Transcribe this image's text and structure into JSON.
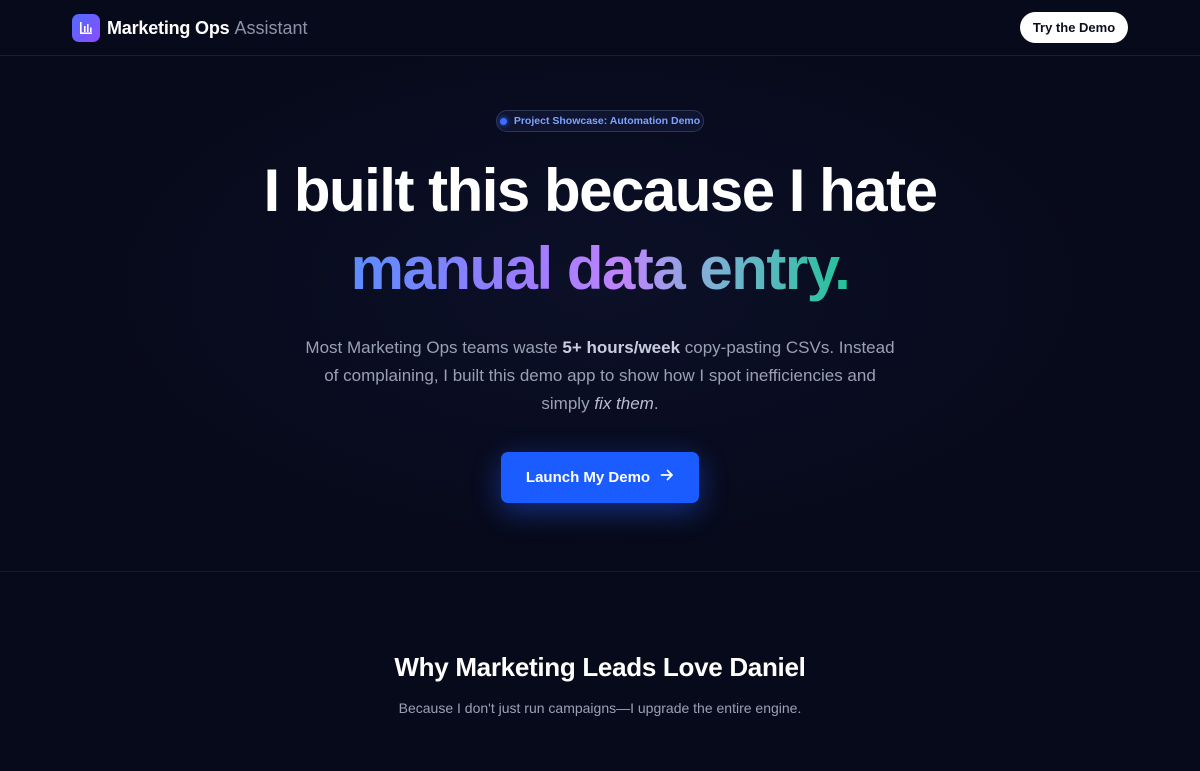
{
  "header": {
    "brand_name": "Marketing Ops",
    "brand_suffix": "Assistant",
    "logo_icon": "bar-chart-icon",
    "cta_label": "Try the Demo"
  },
  "hero": {
    "badge": "Project Showcase: Automation Demo",
    "headline_line1": "I built this because I hate",
    "headline_line2": "manual data entry.",
    "sub_part1": "Most Marketing Ops teams waste ",
    "sub_bold": "5+ hours/week",
    "sub_part2": " copy-pasting CSVs. Instead of complaining, I built this demo app to show how I spot inefficiencies and simply ",
    "sub_italic": "fix them",
    "sub_part3": ".",
    "cta_label": "Launch My Demo",
    "cta_icon": "arrow-right-icon"
  },
  "section": {
    "title": "Why Marketing Leads Love Daniel",
    "subtitle": "Because I don't just run campaigns—I upgrade the entire engine."
  },
  "colors": {
    "background": "#070a1a",
    "accent_blue": "#1a5cff",
    "gradient_start": "#5b8cff",
    "gradient_mid": "#c084fc",
    "gradient_end": "#22c39a"
  }
}
